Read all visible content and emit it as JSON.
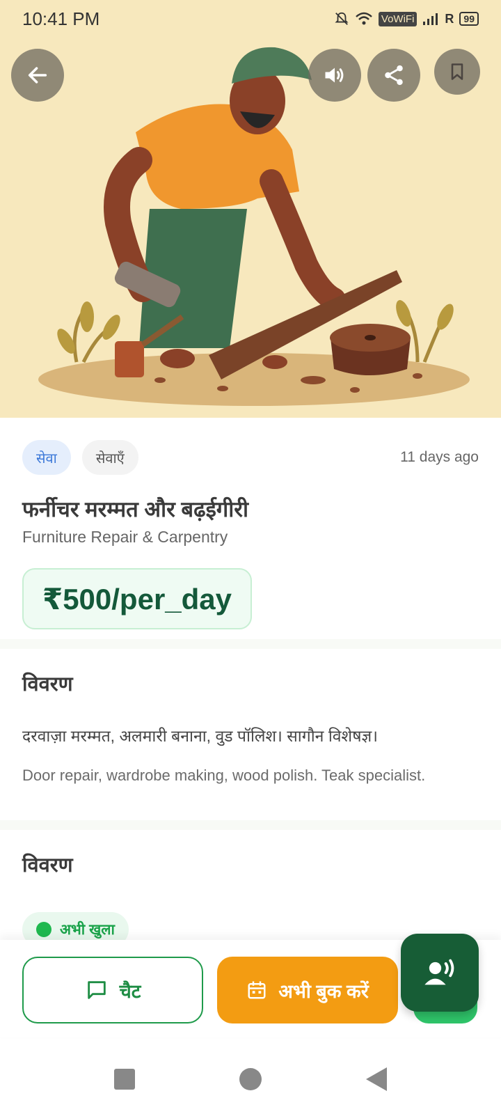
{
  "status_bar": {
    "time": "10:41 PM",
    "vowifi": "VoWiFi",
    "roaming": "R",
    "battery": "99"
  },
  "colors": {
    "brand_green": "#175d36",
    "accent_orange": "#f39c12",
    "price_bg": "#effbf3",
    "chip_blue": "#3b78d8"
  },
  "hero": {
    "icons": [
      "back-arrow-icon",
      "speaker-icon",
      "share-icon",
      "bookmark-icon"
    ]
  },
  "listing": {
    "chip_primary": "सेवा",
    "chip_secondary": "सेवाएँ",
    "posted": "11 days ago",
    "title_hi": "फर्नीचर मरम्मत और बढ़ईगीरी",
    "title_en": "Furniture Repair & Carpentry",
    "price": "₹500/per_day"
  },
  "description": {
    "heading": "विवरण",
    "text_hi": "दरवाज़ा मरम्मत, अलमारी बनाना, वुड पॉलिश। सागौन विशेषज्ञ।",
    "text_en": "Door repair, wardrobe making, wood polish. Teak specialist."
  },
  "availability": {
    "heading": "विवरण",
    "status": "अभी खुला"
  },
  "actions": {
    "chat_label": "चैट",
    "book_label": "अभी बुक करें"
  }
}
